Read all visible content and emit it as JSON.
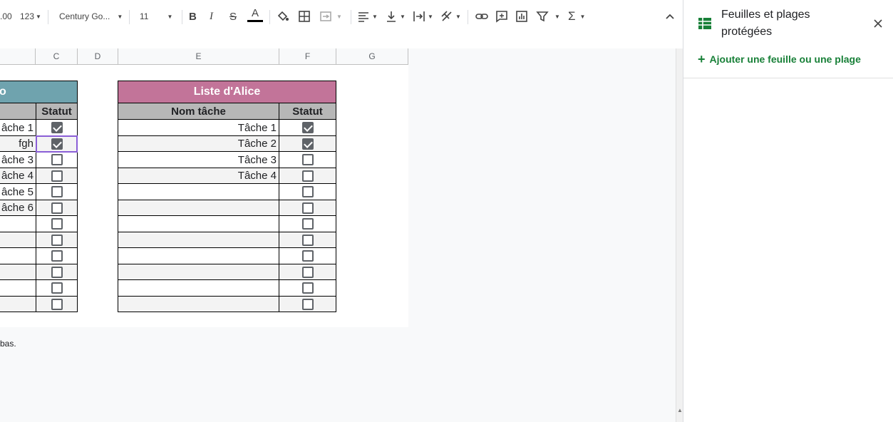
{
  "toolbar": {
    "decimal_label": ".00",
    "format_label": "123",
    "font_name": "Century Go...",
    "font_size": "11"
  },
  "columns": [
    "C",
    "D",
    "E",
    "F",
    "G"
  ],
  "left_table": {
    "title": "o",
    "status_header": "Statut",
    "rows": [
      {
        "name": "âche 1",
        "checked": true
      },
      {
        "name": "fgh",
        "checked": true
      },
      {
        "name": "âche 3",
        "checked": false
      },
      {
        "name": "âche 4",
        "checked": false
      },
      {
        "name": "âche 5",
        "checked": false
      },
      {
        "name": "âche 6",
        "checked": false
      },
      {
        "name": "",
        "checked": false
      },
      {
        "name": "",
        "checked": false
      },
      {
        "name": "",
        "checked": false
      },
      {
        "name": "",
        "checked": false
      },
      {
        "name": "",
        "checked": false
      },
      {
        "name": "",
        "checked": false
      }
    ]
  },
  "right_table": {
    "title": "Liste d'Alice",
    "name_header": "Nom tâche",
    "status_header": "Statut",
    "rows": [
      {
        "name": "Tâche 1",
        "checked": true
      },
      {
        "name": "Tâche 2",
        "checked": true
      },
      {
        "name": "Tâche 3",
        "checked": false
      },
      {
        "name": "Tâche 4",
        "checked": false
      },
      {
        "name": "",
        "checked": false
      },
      {
        "name": "",
        "checked": false
      },
      {
        "name": "",
        "checked": false
      },
      {
        "name": "",
        "checked": false
      },
      {
        "name": "",
        "checked": false
      },
      {
        "name": "",
        "checked": false
      },
      {
        "name": "",
        "checked": false
      },
      {
        "name": "",
        "checked": false
      }
    ]
  },
  "note_text": "bas.",
  "panel": {
    "title": "Feuilles et plages protégées",
    "add_label": "Ajouter une feuille ou une plage"
  },
  "colors": {
    "left_title_bg": "#6fa3ae",
    "right_title_bg": "#c27499",
    "accent_green": "#188038",
    "selection": "#8a5ed6"
  }
}
